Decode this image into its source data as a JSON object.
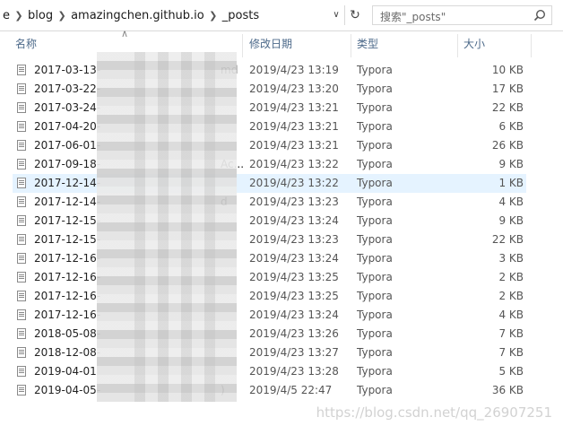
{
  "address": {
    "crumbs": [
      "e",
      "blog",
      "amazingchen.github.io",
      "_posts"
    ],
    "search_placeholder": "搜索\"_posts\""
  },
  "columns": {
    "name": "名称",
    "date": "修改日期",
    "type": "类型",
    "size": "大小"
  },
  "files": [
    {
      "name": "2017-03-13-",
      "suffix": "md",
      "date": "2019/4/23 13:19",
      "type": "Typora",
      "size": "10 KB"
    },
    {
      "name": "2017-03-22-",
      "suffix": "",
      "date": "2019/4/23 13:20",
      "type": "Typora",
      "size": "17 KB"
    },
    {
      "name": "2017-03-24-",
      "suffix": "",
      "date": "2019/4/23 13:21",
      "type": "Typora",
      "size": "22 KB"
    },
    {
      "name": "2017-04-20-",
      "suffix": "",
      "date": "2019/4/23 13:21",
      "type": "Typora",
      "size": "6 KB"
    },
    {
      "name": "2017-06-01-",
      "suffix": "",
      "date": "2019/4/23 13:21",
      "type": "Typora",
      "size": "26 KB"
    },
    {
      "name": "2017-09-18-",
      "suffix": "Ac...",
      "date": "2019/4/23 13:22",
      "type": "Typora",
      "size": "9 KB"
    },
    {
      "name": "2017-12-14-",
      "suffix": "",
      "date": "2019/4/23 13:22",
      "type": "Typora",
      "size": "1 KB"
    },
    {
      "name": "2017-12-14-",
      "suffix": "d",
      "date": "2019/4/23 13:23",
      "type": "Typora",
      "size": "4 KB"
    },
    {
      "name": "2017-12-15-",
      "suffix": "",
      "date": "2019/4/23 13:24",
      "type": "Typora",
      "size": "9 KB"
    },
    {
      "name": "2017-12-15-",
      "suffix": "",
      "date": "2019/4/23 13:23",
      "type": "Typora",
      "size": "22 KB"
    },
    {
      "name": "2017-12-16-",
      "suffix": "",
      "date": "2019/4/23 13:24",
      "type": "Typora",
      "size": "3 KB"
    },
    {
      "name": "2017-12-16-",
      "suffix": "",
      "date": "2019/4/23 13:25",
      "type": "Typora",
      "size": "2 KB"
    },
    {
      "name": "2017-12-16-",
      "suffix": "",
      "date": "2019/4/23 13:25",
      "type": "Typora",
      "size": "2 KB"
    },
    {
      "name": "2017-12-16-",
      "suffix": "",
      "date": "2019/4/23 13:24",
      "type": "Typora",
      "size": "4 KB"
    },
    {
      "name": "2018-05-08-",
      "suffix": "",
      "date": "2019/4/23 13:26",
      "type": "Typora",
      "size": "7 KB"
    },
    {
      "name": "2018-12-08-",
      "suffix": "",
      "date": "2019/4/23 13:27",
      "type": "Typora",
      "size": "7 KB"
    },
    {
      "name": "2019-04-01",
      "suffix": "",
      "date": "2019/4/23 13:28",
      "type": "Typora",
      "size": "5 KB"
    },
    {
      "name": "2019-04-05-",
      "suffix": ")",
      "date": "2019/4/5 22:47",
      "type": "Typora",
      "size": "36 KB"
    }
  ],
  "selected_index": 6,
  "watermark": "https://blog.csdn.net/qq_26907251"
}
